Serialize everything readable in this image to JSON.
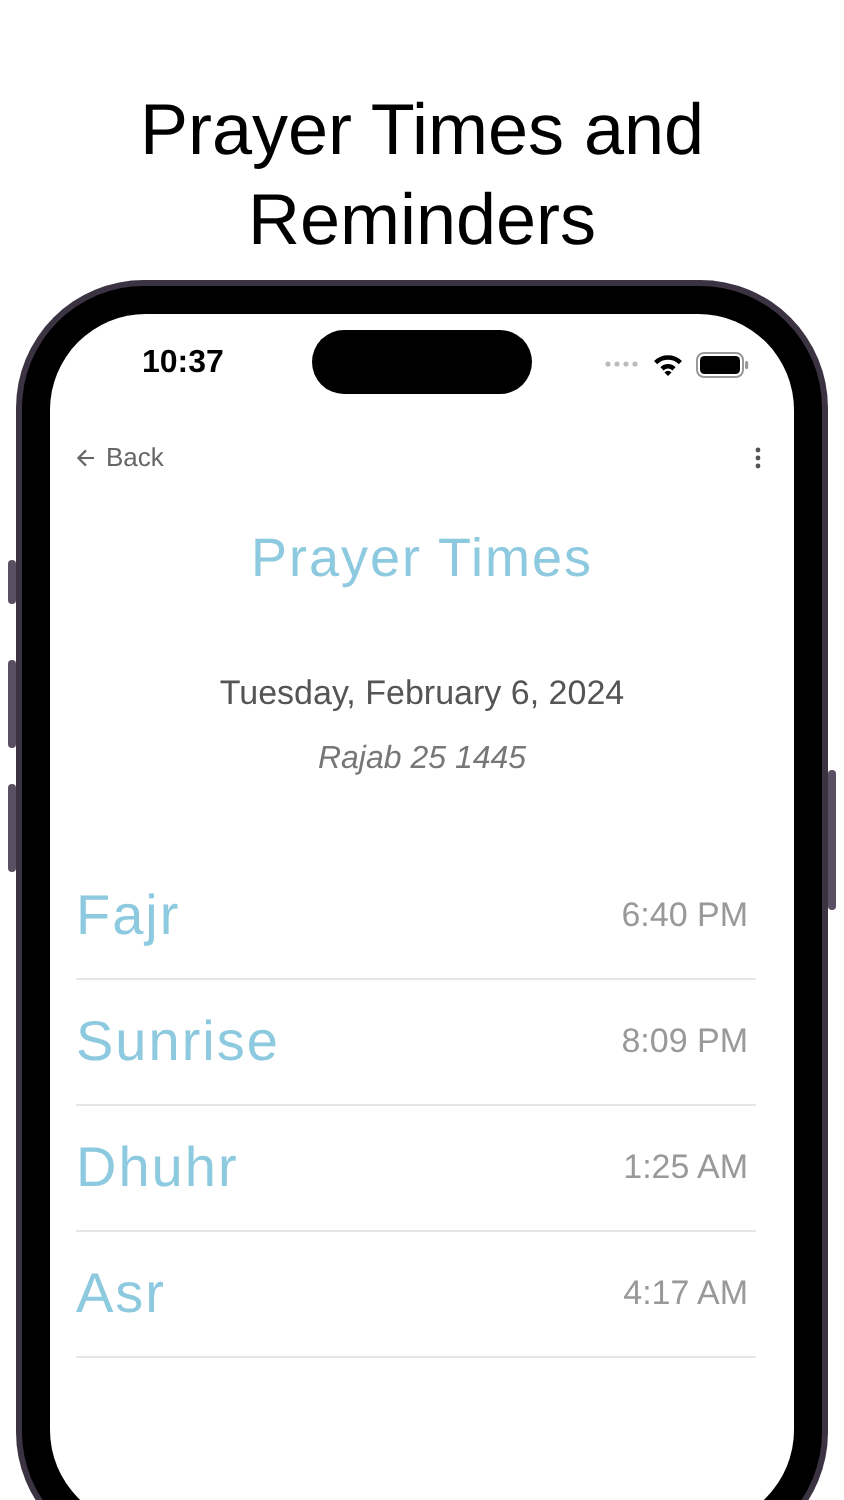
{
  "headline": "Prayer Times and Reminders",
  "status_bar": {
    "time": "10:37"
  },
  "nav": {
    "back": "Back"
  },
  "title": "Prayer Times",
  "date": "Tuesday, February 6, 2024",
  "hijri_date": "Rajab 25 1445",
  "prayers": [
    {
      "name": "Fajr",
      "time": "6:40 PM"
    },
    {
      "name": "Sunrise",
      "time": "8:09 PM"
    },
    {
      "name": "Dhuhr",
      "time": "1:25 AM"
    },
    {
      "name": "Asr",
      "time": "4:17 AM"
    }
  ]
}
